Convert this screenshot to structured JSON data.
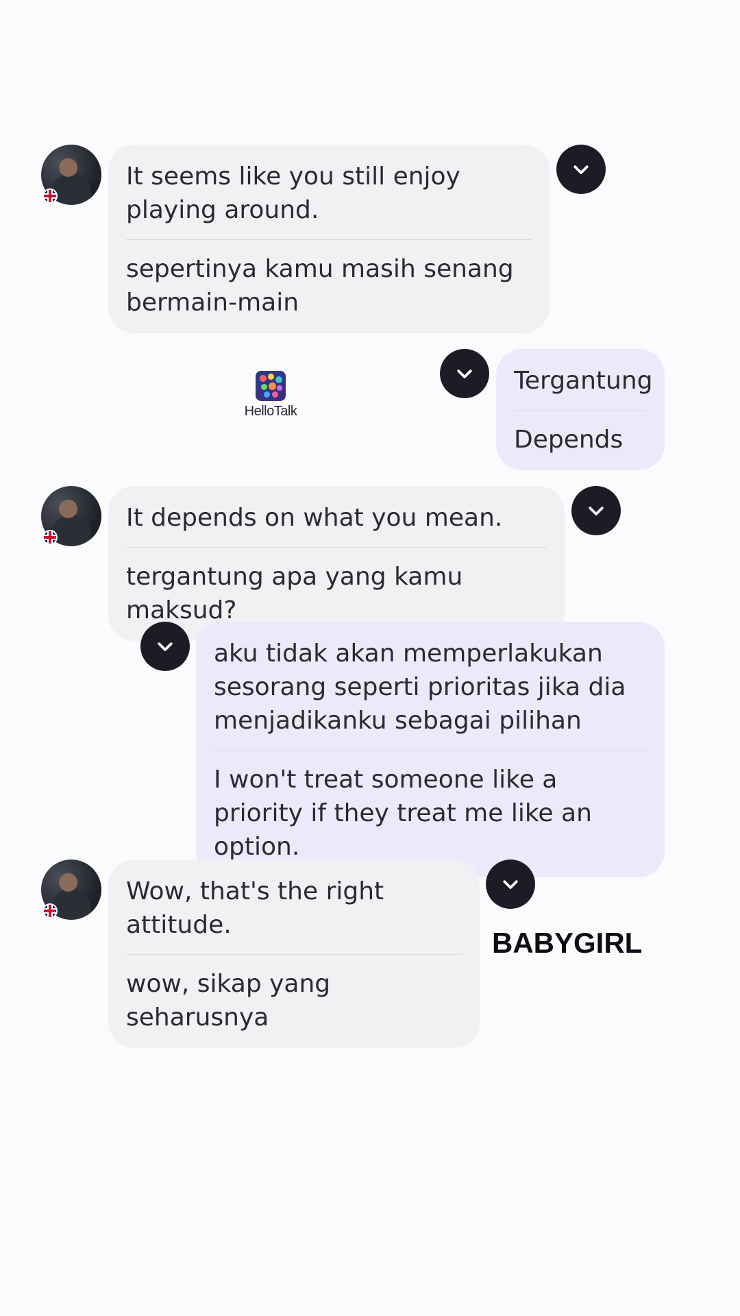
{
  "messages": [
    {
      "side": "incoming",
      "original": "It seems like you still enjoy playing around.",
      "translation": "sepertinya kamu masih senang bermain-main"
    },
    {
      "side": "outgoing",
      "original": "Tergantung",
      "translation": "Depends"
    },
    {
      "side": "incoming",
      "original": "It depends on what you mean.",
      "translation": "tergantung apa yang kamu maksud?"
    },
    {
      "side": "outgoing",
      "original": "aku tidak akan memperlakukan sesorang seperti prioritas jika dia menjadikanku sebagai pilihan",
      "translation": "I won't treat someone like a priority if they treat me like an option."
    },
    {
      "side": "incoming",
      "original": "Wow, that's the right attitude.",
      "translation": "wow, sikap yang seharusnya"
    }
  ],
  "watermark": {
    "text": "HelloTalk"
  },
  "caption": "BABYGIRL",
  "icons": {
    "menu": "chevron-down-icon",
    "flag": "uk-flag-icon"
  },
  "colors": {
    "incoming_bubble": "#f1f0f3",
    "outgoing_bubble": "#ece9fb",
    "menu_button": "#1d1c26"
  }
}
